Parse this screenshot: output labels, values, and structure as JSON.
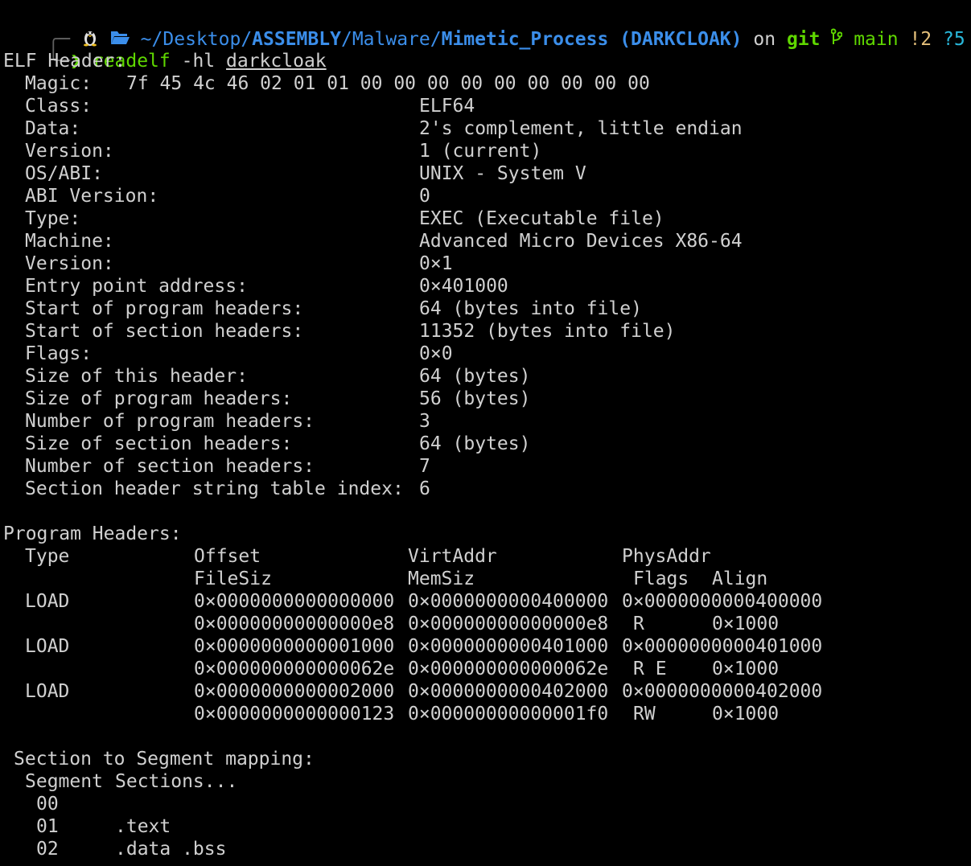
{
  "prompt": {
    "path_home": "~",
    "path_sep": "/",
    "path_seg1": "Desktop",
    "path_seg2": "ASSEMBLY",
    "path_seg3": "Malware",
    "path_seg4": "Mimetic_Process",
    "repo_tag": "(DARKCLOAK)",
    "on_word": "on",
    "git_word": "git",
    "branch": "main",
    "modified": "!2",
    "untracked": "?5",
    "cmd": "readelf",
    "args": "-hl",
    "file": "darkcloak",
    "colors": {
      "path": "#3b8eea",
      "green": "#5fd700",
      "yellow": "#e5c07b",
      "cyan": "#29b8db"
    },
    "icons": [
      "linux-tux-icon",
      "folder-open-icon",
      "git-branch-icon",
      "gear-icon"
    ]
  },
  "elf_header": {
    "title": "ELF Header:",
    "magic_label": "Magic:",
    "magic": "7f 45 4c 46 02 01 01 00 00 00 00 00 00 00 00 00",
    "rows": [
      {
        "label": "Class:",
        "value": "ELF64"
      },
      {
        "label": "Data:",
        "value": "2's complement, little endian"
      },
      {
        "label": "Version:",
        "value": "1 (current)"
      },
      {
        "label": "OS/ABI:",
        "value": "UNIX - System V"
      },
      {
        "label": "ABI Version:",
        "value": "0"
      },
      {
        "label": "Type:",
        "value": "EXEC (Executable file)"
      },
      {
        "label": "Machine:",
        "value": "Advanced Micro Devices X86-64"
      },
      {
        "label": "Version:",
        "value": "0×1"
      },
      {
        "label": "Entry point address:",
        "value": "0×401000"
      },
      {
        "label": "Start of program headers:",
        "value": "64 (bytes into file)"
      },
      {
        "label": "Start of section headers:",
        "value": "11352 (bytes into file)"
      },
      {
        "label": "Flags:",
        "value": "0×0"
      },
      {
        "label": "Size of this header:",
        "value": "64 (bytes)"
      },
      {
        "label": "Size of program headers:",
        "value": "56 (bytes)"
      },
      {
        "label": "Number of program headers:",
        "value": "3"
      },
      {
        "label": "Size of section headers:",
        "value": "64 (bytes)"
      },
      {
        "label": "Number of section headers:",
        "value": "7"
      },
      {
        "label": "Section header string table index:",
        "value": "6"
      }
    ]
  },
  "program_headers": {
    "title": "Program Headers:",
    "col_type": "Type",
    "col_offset": "Offset",
    "col_virtaddr": "VirtAddr",
    "col_physaddr": "PhysAddr",
    "col_filesiz": "FileSiz",
    "col_memsiz": "MemSiz",
    "col_flags": "Flags",
    "col_align": "Align",
    "rows": [
      {
        "type": "LOAD",
        "offset": "0×0000000000000000",
        "virtaddr": "0×0000000000400000",
        "physaddr": "0×0000000000400000",
        "filesiz": "0×00000000000000e8",
        "memsiz": "0×00000000000000e8",
        "flags": "R",
        "align": "0×1000"
      },
      {
        "type": "LOAD",
        "offset": "0×0000000000001000",
        "virtaddr": "0×0000000000401000",
        "physaddr": "0×0000000000401000",
        "filesiz": "0×000000000000062e",
        "memsiz": "0×000000000000062e",
        "flags": "R E",
        "align": "0×1000"
      },
      {
        "type": "LOAD",
        "offset": "0×0000000000002000",
        "virtaddr": "0×0000000000402000",
        "physaddr": "0×0000000000402000",
        "filesiz": "0×0000000000000123",
        "memsiz": "0×00000000000001f0",
        "flags": "RW",
        "align": "0×1000"
      }
    ]
  },
  "mapping": {
    "title": "Section to Segment mapping:",
    "col_segment": "Segment",
    "col_sections": "Sections...",
    "rows": [
      {
        "segment": "00",
        "sections": ""
      },
      {
        "segment": "01",
        "sections": ".text"
      },
      {
        "segment": "02",
        "sections": ".data .bss"
      }
    ]
  }
}
